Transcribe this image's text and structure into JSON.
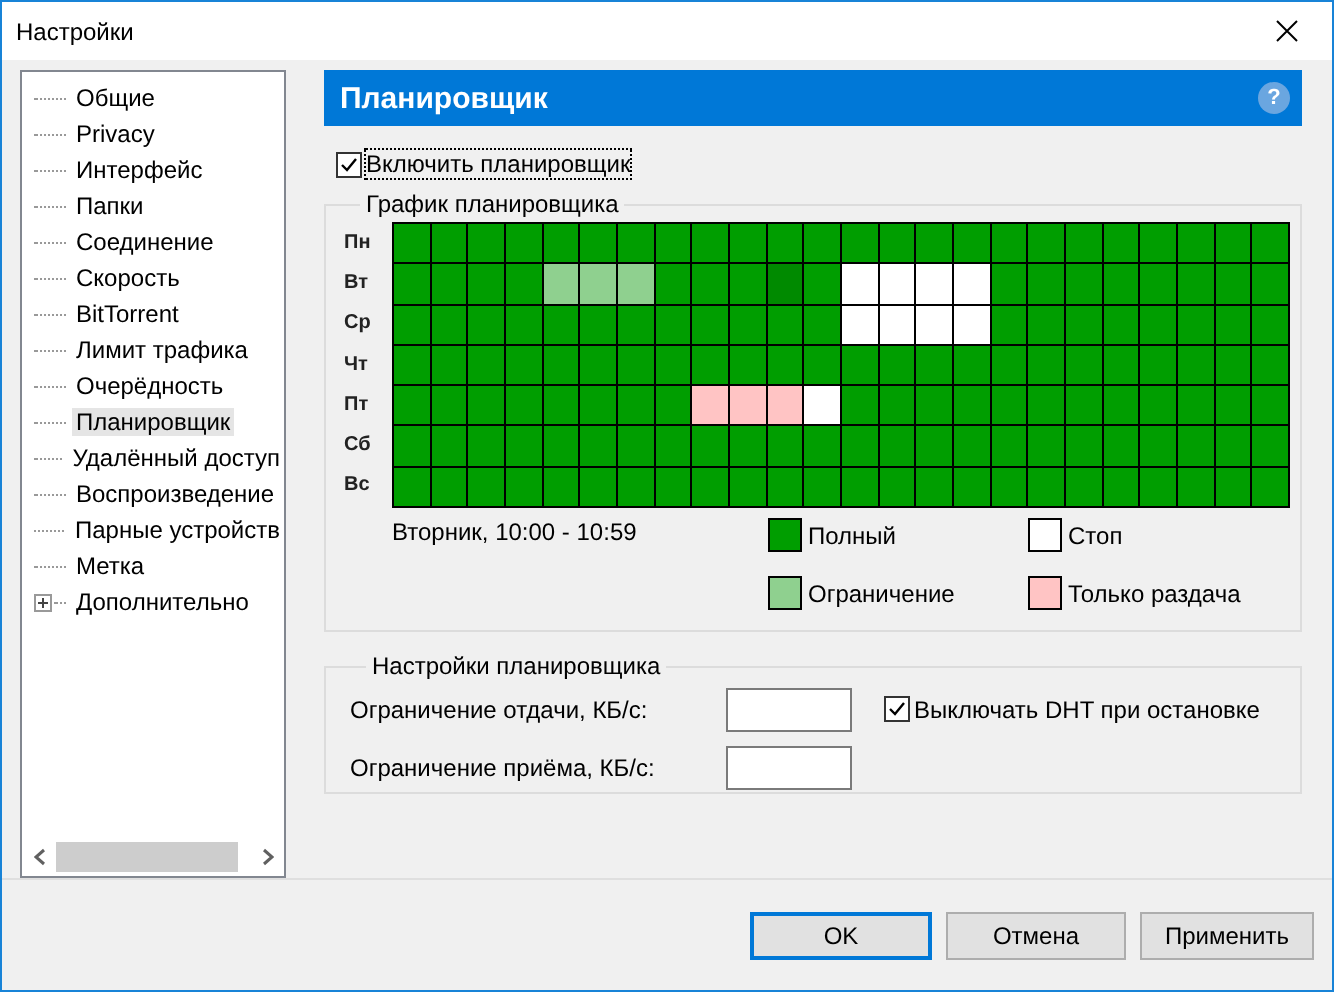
{
  "window": {
    "title": "Настройки"
  },
  "sidebar": {
    "items": [
      {
        "label": "Общие",
        "kind": "leaf",
        "selected": false
      },
      {
        "label": "Privacy",
        "kind": "leaf",
        "selected": false
      },
      {
        "label": "Интерфейс",
        "kind": "leaf",
        "selected": false
      },
      {
        "label": "Папки",
        "kind": "leaf",
        "selected": false
      },
      {
        "label": "Соединение",
        "kind": "leaf",
        "selected": false
      },
      {
        "label": "Скорость",
        "kind": "leaf",
        "selected": false
      },
      {
        "label": "BitTorrent",
        "kind": "leaf",
        "selected": false
      },
      {
        "label": "Лимит трафика",
        "kind": "leaf",
        "selected": false
      },
      {
        "label": "Очерёдность",
        "kind": "leaf",
        "selected": false
      },
      {
        "label": "Планировщик",
        "kind": "leaf",
        "selected": true
      },
      {
        "label": "Удалённый доступ",
        "kind": "leaf",
        "selected": false
      },
      {
        "label": "Воспроизведение",
        "kind": "leaf",
        "selected": false
      },
      {
        "label": "Парные устройств",
        "kind": "leaf",
        "selected": false
      },
      {
        "label": "Метка",
        "kind": "leaf",
        "selected": false
      },
      {
        "label": "Дополнительно",
        "kind": "group",
        "expanded": false,
        "selected": false
      }
    ]
  },
  "header": {
    "title": "Планировщик",
    "help": "?"
  },
  "enable_scheduler": {
    "label": "Включить планировщик",
    "checked": true
  },
  "schedule": {
    "title": "График планировщика",
    "rows": [
      {
        "day": "Пн",
        "cells": [
          {
            "kind": "full"
          },
          {
            "kind": "full"
          },
          {
            "kind": "full"
          },
          {
            "kind": "full"
          },
          {
            "kind": "full"
          },
          {
            "kind": "full"
          },
          {
            "kind": "full"
          },
          {
            "kind": "full"
          },
          {
            "kind": "full"
          },
          {
            "kind": "full"
          },
          {
            "kind": "full"
          },
          {
            "kind": "full"
          },
          {
            "kind": "full"
          },
          {
            "kind": "full"
          },
          {
            "kind": "full"
          },
          {
            "kind": "full"
          },
          {
            "kind": "full"
          },
          {
            "kind": "full"
          },
          {
            "kind": "full"
          },
          {
            "kind": "full"
          },
          {
            "kind": "full"
          },
          {
            "kind": "full"
          },
          {
            "kind": "full"
          },
          {
            "kind": "full"
          }
        ]
      },
      {
        "day": "Вт",
        "cells": [
          {
            "kind": "full"
          },
          {
            "kind": "full"
          },
          {
            "kind": "full"
          },
          {
            "kind": "full"
          },
          {
            "kind": "limit"
          },
          {
            "kind": "limit"
          },
          {
            "kind": "limit"
          },
          {
            "kind": "full"
          },
          {
            "kind": "full"
          },
          {
            "kind": "full"
          },
          {
            "kind": "hover"
          },
          {
            "kind": "full"
          },
          {
            "kind": "stop"
          },
          {
            "kind": "stop"
          },
          {
            "kind": "stop"
          },
          {
            "kind": "stop"
          },
          {
            "kind": "full"
          },
          {
            "kind": "full"
          },
          {
            "kind": "full"
          },
          {
            "kind": "full"
          },
          {
            "kind": "full"
          },
          {
            "kind": "full"
          },
          {
            "kind": "full"
          },
          {
            "kind": "full"
          }
        ]
      },
      {
        "day": "Ср",
        "cells": [
          {
            "kind": "full"
          },
          {
            "kind": "full"
          },
          {
            "kind": "full"
          },
          {
            "kind": "full"
          },
          {
            "kind": "full"
          },
          {
            "kind": "full"
          },
          {
            "kind": "full"
          },
          {
            "kind": "full"
          },
          {
            "kind": "full"
          },
          {
            "kind": "full"
          },
          {
            "kind": "full"
          },
          {
            "kind": "full"
          },
          {
            "kind": "stop"
          },
          {
            "kind": "stop"
          },
          {
            "kind": "stop"
          },
          {
            "kind": "stop"
          },
          {
            "kind": "full"
          },
          {
            "kind": "full"
          },
          {
            "kind": "full"
          },
          {
            "kind": "full"
          },
          {
            "kind": "full"
          },
          {
            "kind": "full"
          },
          {
            "kind": "full"
          },
          {
            "kind": "full"
          }
        ]
      },
      {
        "day": "Чт",
        "cells": [
          {
            "kind": "full"
          },
          {
            "kind": "full"
          },
          {
            "kind": "full"
          },
          {
            "kind": "full"
          },
          {
            "kind": "full"
          },
          {
            "kind": "full"
          },
          {
            "kind": "full"
          },
          {
            "kind": "full"
          },
          {
            "kind": "full"
          },
          {
            "kind": "full"
          },
          {
            "kind": "full"
          },
          {
            "kind": "full"
          },
          {
            "kind": "full"
          },
          {
            "kind": "full"
          },
          {
            "kind": "full"
          },
          {
            "kind": "full"
          },
          {
            "kind": "full"
          },
          {
            "kind": "full"
          },
          {
            "kind": "full"
          },
          {
            "kind": "full"
          },
          {
            "kind": "full"
          },
          {
            "kind": "full"
          },
          {
            "kind": "full"
          },
          {
            "kind": "full"
          }
        ]
      },
      {
        "day": "Пт",
        "cells": [
          {
            "kind": "full"
          },
          {
            "kind": "full"
          },
          {
            "kind": "full"
          },
          {
            "kind": "full"
          },
          {
            "kind": "full"
          },
          {
            "kind": "full"
          },
          {
            "kind": "full"
          },
          {
            "kind": "full"
          },
          {
            "kind": "seed"
          },
          {
            "kind": "seed"
          },
          {
            "kind": "seed"
          },
          {
            "kind": "stop"
          },
          {
            "kind": "full"
          },
          {
            "kind": "full"
          },
          {
            "kind": "full"
          },
          {
            "kind": "full"
          },
          {
            "kind": "full"
          },
          {
            "kind": "full"
          },
          {
            "kind": "full"
          },
          {
            "kind": "full"
          },
          {
            "kind": "full"
          },
          {
            "kind": "full"
          },
          {
            "kind": "full"
          },
          {
            "kind": "full"
          }
        ]
      },
      {
        "day": "Сб",
        "cells": [
          {
            "kind": "full"
          },
          {
            "kind": "full"
          },
          {
            "kind": "full"
          },
          {
            "kind": "full"
          },
          {
            "kind": "full"
          },
          {
            "kind": "full"
          },
          {
            "kind": "full"
          },
          {
            "kind": "full"
          },
          {
            "kind": "full"
          },
          {
            "kind": "full"
          },
          {
            "kind": "full"
          },
          {
            "kind": "full"
          },
          {
            "kind": "full"
          },
          {
            "kind": "full"
          },
          {
            "kind": "full"
          },
          {
            "kind": "full"
          },
          {
            "kind": "full"
          },
          {
            "kind": "full"
          },
          {
            "kind": "full"
          },
          {
            "kind": "full"
          },
          {
            "kind": "full"
          },
          {
            "kind": "full"
          },
          {
            "kind": "full"
          },
          {
            "kind": "full"
          }
        ]
      },
      {
        "day": "Вс",
        "cells": [
          {
            "kind": "full"
          },
          {
            "kind": "full"
          },
          {
            "kind": "full"
          },
          {
            "kind": "full"
          },
          {
            "kind": "full"
          },
          {
            "kind": "full"
          },
          {
            "kind": "full"
          },
          {
            "kind": "full"
          },
          {
            "kind": "full"
          },
          {
            "kind": "full"
          },
          {
            "kind": "full"
          },
          {
            "kind": "full"
          },
          {
            "kind": "full"
          },
          {
            "kind": "full"
          },
          {
            "kind": "full"
          },
          {
            "kind": "full"
          },
          {
            "kind": "full"
          },
          {
            "kind": "full"
          },
          {
            "kind": "full"
          },
          {
            "kind": "full"
          },
          {
            "kind": "full"
          },
          {
            "kind": "full"
          },
          {
            "kind": "full"
          },
          {
            "kind": "full"
          }
        ]
      }
    ],
    "status": "Вторник, 10:00 - 10:59",
    "legend": [
      {
        "label": "Полный",
        "color": "#009e00"
      },
      {
        "label": "Стоп",
        "color": "#ffffff"
      },
      {
        "label": "Ограничение",
        "color": "#8fd08f"
      },
      {
        "label": "Только раздача",
        "color": "#ffc4c4"
      }
    ]
  },
  "settings": {
    "title": "Настройки планировщика",
    "upload_label": "Ограничение отдачи, КБ/с:",
    "download_label": "Ограничение приёма, КБ/с:",
    "disable_dht": {
      "label": "Выключать DHT при остановке",
      "checked": true
    }
  },
  "buttons": [
    {
      "label": "OK",
      "kind": "default"
    },
    {
      "label": "Отмена",
      "kind": "normal"
    },
    {
      "label": "Применить",
      "kind": "normal"
    }
  ]
}
